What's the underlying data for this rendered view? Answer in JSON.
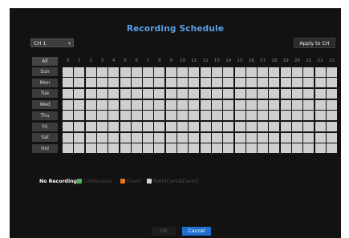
{
  "dialog": {
    "title": "Recording Schedule"
  },
  "channel_select": {
    "value": "CH 1",
    "arrow": "▾"
  },
  "apply_button": {
    "label": "Apply to CH"
  },
  "grid": {
    "all_label": "All",
    "hours": [
      "0",
      "1",
      "2",
      "3",
      "4",
      "5",
      "6",
      "7",
      "8",
      "9",
      "10",
      "11",
      "12",
      "13",
      "14",
      "15",
      "16",
      "17",
      "18",
      "19",
      "20",
      "21",
      "22",
      "23"
    ],
    "days": [
      "Sun",
      "Mon",
      "Tue",
      "Wed",
      "Thu",
      "Fri",
      "Sat",
      "Hol"
    ],
    "row_arrow": "▸",
    "cell_state": "Both(Cont&Event)"
  },
  "legend": {
    "items": [
      {
        "label": "No Recording",
        "color": "#ffffff",
        "text_color": "#ffffff"
      },
      {
        "label": "Continuous",
        "color": "#49b54a",
        "text_color": "#4f4f4f"
      },
      {
        "label": "Event",
        "color": "#e5731f",
        "text_color": "#4f4f4f"
      },
      {
        "label": "Both(Cont&Event)",
        "color": "#d4d4d4",
        "text_color": "#4f4f4f"
      }
    ]
  },
  "footer": {
    "ok_label": "OK",
    "cancel_label": "Cancel",
    "ok_color": "#1d1d1d",
    "cancel_color": "#1f6fd0"
  }
}
